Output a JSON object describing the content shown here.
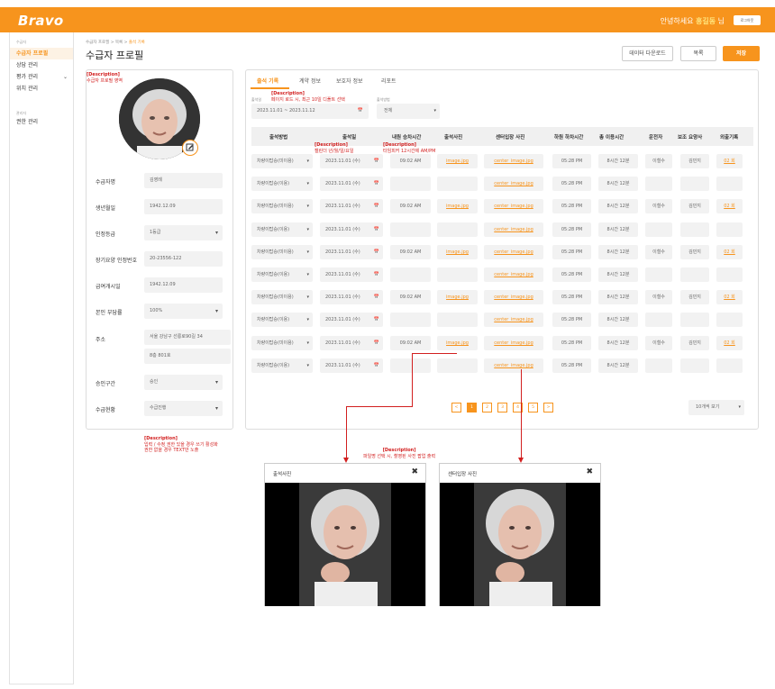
{
  "header": {
    "logo": "Bravo",
    "greeting_prefix": "안녕하세요 ",
    "user_name": "홍길동",
    "greeting_suffix": " 님",
    "logout": "로그아웃"
  },
  "sidebar": {
    "section1": "수급자",
    "items": [
      {
        "label": "수급자 프로필"
      },
      {
        "label": "상담 관리"
      },
      {
        "label": "평가 관리"
      },
      {
        "label": "위치 관리"
      }
    ],
    "section2": "관리자",
    "admin_items": [
      {
        "label": "권한 관리"
      }
    ]
  },
  "breadcrumb": {
    "path": "수급자 프로필 > 목록 > ",
    "current": "출석 기록"
  },
  "page_title": "수급자 프로필",
  "buttons": {
    "download": "데이터 다운로드",
    "list": "목록",
    "save": "저장"
  },
  "descriptions": {
    "profile": {
      "tag": "[Description]",
      "text": "수급자 프로필 영역"
    },
    "period": {
      "tag": "[Description]",
      "text": "페이지 로드 시, 최근 10일 디폴트 선택"
    },
    "calendar": {
      "tag": "[Description]",
      "text": "캘린더 년/월/일/요일"
    },
    "timepicker": {
      "tag": "[Description]",
      "text": "타임피커 12시간제 AM/PM"
    },
    "edit": {
      "tag": "[Description]",
      "line1": "입력 / 수정 권한 있을 경우 쓰기 활성화",
      "line2": "권한 없을 경우 TEXT만 노출"
    },
    "file": {
      "tag": "[Description]",
      "text": "파일명 선택 시, 촬영된 사진 팝업 출력"
    }
  },
  "profile": {
    "fields": [
      {
        "label": "수급자명",
        "value": "김영례"
      },
      {
        "label": "생년월일",
        "value": "1942.12.09"
      },
      {
        "label": "인정등급",
        "value": "1등급"
      },
      {
        "label": "장기요양 인정번호",
        "value": "20-23556-122"
      },
      {
        "label": "급여개시일",
        "value": "1942.12.09"
      },
      {
        "label": "본인 부담률",
        "value": "100%"
      },
      {
        "label": "주소",
        "value": "서울 강남구 선릉로90길 34",
        "value2": "8층 801호"
      },
      {
        "label": "승인구간",
        "value": "승인"
      },
      {
        "label": "수급현황",
        "value": "수급진행"
      }
    ]
  },
  "tabs": [
    "출석 기록",
    "계약 정보",
    "보호자 정보",
    "리포트"
  ],
  "filters": {
    "period_label": "출석일",
    "period_value": "2023.11.01 ~ 2023.11.12",
    "method_label": "출석방법",
    "method_value": "전체"
  },
  "table": {
    "headers": [
      "출석방법",
      "출석일",
      "내원 승차시간",
      "출석사진",
      "센터입장 사진",
      "하원 하차시간",
      "총 이용시간",
      "운전자",
      "보조 요양사",
      "외출기록"
    ],
    "rows": [
      {
        "method": "차량이탑승(미이용)",
        "date": "2023.11.01 (수)",
        "time_in": "09:02 AM",
        "photo": "image.jpg",
        "center": "center_image.jpg",
        "time_out": "05:28 PM",
        "total": "8시간 12분",
        "driver": "이철수",
        "assistant": "김민지",
        "outing": "02 회"
      },
      {
        "method": "차량이탑승(이용)",
        "date": "2023.11.01 (수)",
        "time_in": "",
        "photo": "",
        "center": "center_image.jpg",
        "time_out": "05:28 PM",
        "total": "8시간 12분",
        "driver": "",
        "assistant": "",
        "outing": ""
      },
      {
        "method": "차량이탑승(미이용)",
        "date": "2023.11.01 (수)",
        "time_in": "09:02 AM",
        "photo": "image.jpg",
        "center": "center_image.jpg",
        "time_out": "05:28 PM",
        "total": "8시간 12분",
        "driver": "이철수",
        "assistant": "김민지",
        "outing": "02 회"
      },
      {
        "method": "차량이탑승(이용)",
        "date": "2023.11.01 (수)",
        "time_in": "",
        "photo": "",
        "center": "center_image.jpg",
        "time_out": "05:28 PM",
        "total": "8시간 12분",
        "driver": "",
        "assistant": "",
        "outing": ""
      },
      {
        "method": "차량이탑승(미이용)",
        "date": "2023.11.01 (수)",
        "time_in": "09:02 AM",
        "photo": "image.jpg",
        "center": "center_image.jpg",
        "time_out": "05:28 PM",
        "total": "8시간 12분",
        "driver": "이철수",
        "assistant": "김민지",
        "outing": "02 회"
      },
      {
        "method": "차량이탑승(이용)",
        "date": "2023.11.01 (수)",
        "time_in": "",
        "photo": "",
        "center": "center_image.jpg",
        "time_out": "05:28 PM",
        "total": "8시간 12분",
        "driver": "",
        "assistant": "",
        "outing": ""
      },
      {
        "method": "차량이탑승(미이용)",
        "date": "2023.11.01 (수)",
        "time_in": "09:02 AM",
        "photo": "image.jpg",
        "center": "center_image.jpg",
        "time_out": "05:28 PM",
        "total": "8시간 12분",
        "driver": "이철수",
        "assistant": "김민지",
        "outing": "02 회"
      },
      {
        "method": "차량이탑승(이용)",
        "date": "2023.11.01 (수)",
        "time_in": "",
        "photo": "",
        "center": "center_image.jpg",
        "time_out": "05:28 PM",
        "total": "8시간 12분",
        "driver": "",
        "assistant": "",
        "outing": ""
      },
      {
        "method": "차량이탑승(미이용)",
        "date": "2023.11.01 (수)",
        "time_in": "09:02 AM",
        "photo": "image.jpg",
        "center": "center_image.jpg",
        "time_out": "05:28 PM",
        "total": "8시간 12분",
        "driver": "이철수",
        "assistant": "김민지",
        "outing": "02 회"
      },
      {
        "method": "차량이탑승(이용)",
        "date": "2023.11.01 (수)",
        "time_in": "",
        "photo": "",
        "center": "center_image.jpg",
        "time_out": "05:28 PM",
        "total": "8시간 12분",
        "driver": "",
        "assistant": "",
        "outing": ""
      }
    ]
  },
  "pagination": {
    "prev": "<",
    "pages": [
      "1",
      "2",
      "3",
      "4",
      "5"
    ],
    "next": ">",
    "page_size": "10개씩 보기"
  },
  "modals": {
    "attendance_title": "출석사진",
    "center_title": "센터입장 사진",
    "close": "✖"
  },
  "colors": {
    "brand": "#f7941d",
    "annotation": "#d21f1f"
  }
}
